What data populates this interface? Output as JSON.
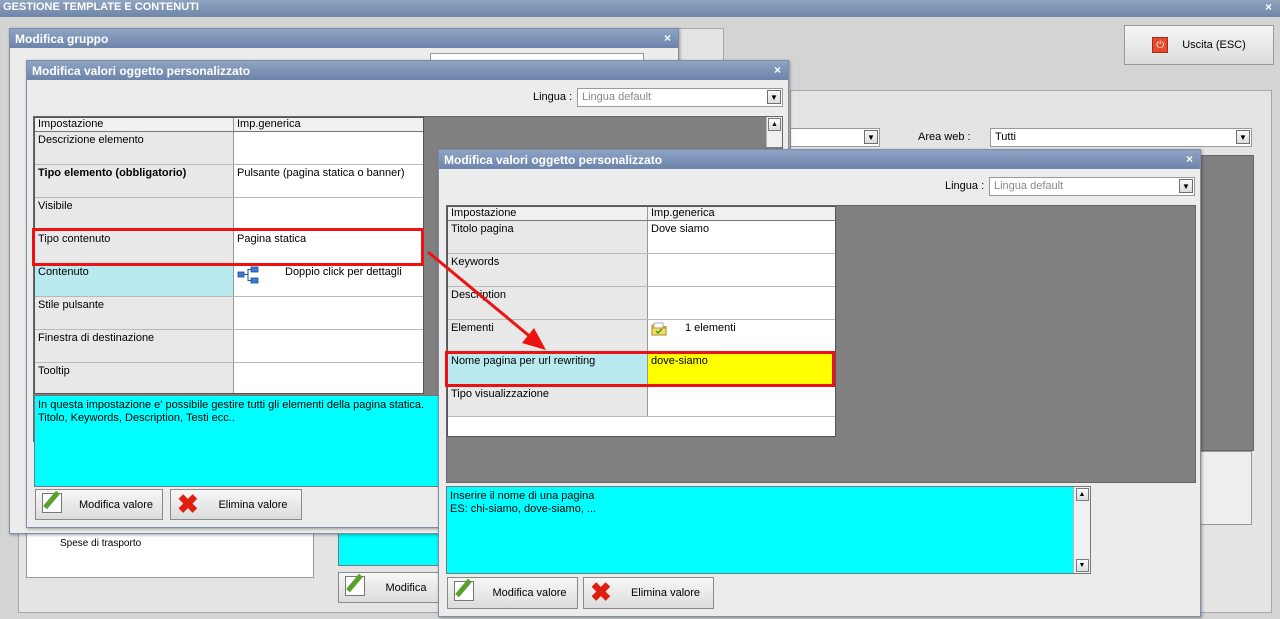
{
  "main": {
    "title": "GESTIONE TEMPLATE E CONTENUTI",
    "close_icon": "×",
    "exit_label": "Uscita (ESC)",
    "area_web_label": "Area web :",
    "area_web_value": "Tutti",
    "bottom_modify_label": "Modifica",
    "tree_item": "Spese di trasporto"
  },
  "dialog_group": {
    "title": "Modifica gruppo",
    "close_icon": "×"
  },
  "dialog_left": {
    "title": "Modifica valori oggetto personalizzato",
    "close_icon": "×",
    "lingua_label": "Lingua :",
    "lingua_value": "Lingua default",
    "col1": "Impostazione",
    "col2": "Imp.generica",
    "rows": [
      {
        "name": "Descrizione elemento",
        "value": ""
      },
      {
        "name": "Tipo elemento (obbligatorio)",
        "value": "Pulsante (pagina statica o banner)"
      },
      {
        "name": "Visibile",
        "value": ""
      },
      {
        "name": "Tipo contenuto",
        "value": "Pagina statica"
      },
      {
        "name": "Contenuto",
        "value": "Doppio click per dettagli"
      },
      {
        "name": "Stile pulsante",
        "value": ""
      },
      {
        "name": "Finestra di destinazione",
        "value": ""
      },
      {
        "name": "Tooltip",
        "value": ""
      }
    ],
    "help_line1": "In questa impostazione e' possibile gestire tutti gli elementi della pagina statica.",
    "help_line2": "Titolo, Keywords, Description, Testi ecc..",
    "btn_modify": "Modifica valore",
    "btn_delete": "Elimina valore"
  },
  "dialog_right": {
    "title": "Modifica valori oggetto personalizzato",
    "close_icon": "×",
    "lingua_label": "Lingua :",
    "lingua_value": "Lingua default",
    "col1": "Impostazione",
    "col2": "Imp.generica",
    "rows": [
      {
        "name": "Titolo pagina",
        "value": "Dove siamo"
      },
      {
        "name": "Keywords",
        "value": ""
      },
      {
        "name": "Description",
        "value": ""
      },
      {
        "name": "Elementi",
        "value": "1 elementi"
      },
      {
        "name": "Nome pagina per url rewriting",
        "value": "dove-siamo"
      },
      {
        "name": "Tipo visualizzazione",
        "value": ""
      }
    ],
    "help_line1": "Inserire il nome di una pagina",
    "help_line2": "ES: chi-siamo, dove-siamo, ...",
    "btn_modify": "Modifica valore",
    "btn_delete": "Elimina valore"
  },
  "colors": {
    "help_bg": "#00ffff",
    "highlight_yellow": "#ffff00",
    "highlight_border": "#ee1111",
    "selected_cell": "#b8eaf0"
  }
}
